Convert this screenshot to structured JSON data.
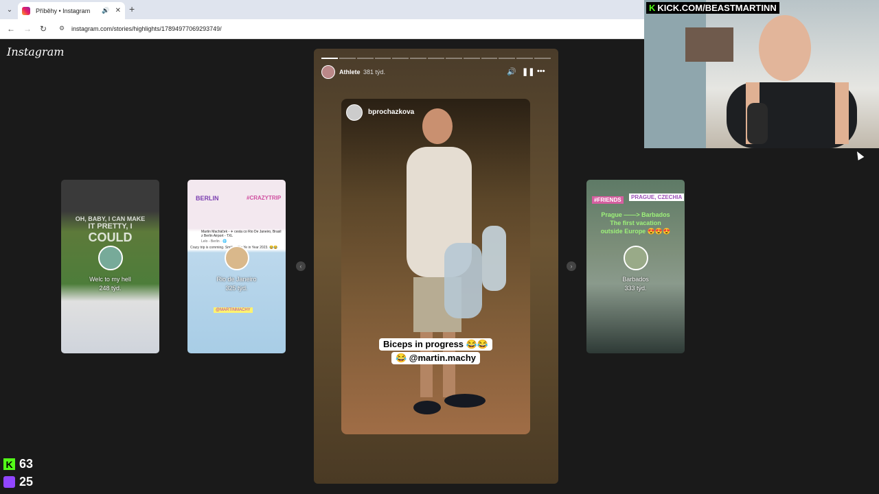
{
  "browser": {
    "tab_title": "Příběhy • Instagram",
    "url": "instagram.com/stories/highlights/17894977069293749/"
  },
  "instagram": {
    "logo": "Instagram"
  },
  "main_story": {
    "username": "Athlete",
    "time": "381 týd.",
    "inner_username": "bprochazkova",
    "caption_line1": "Biceps in progress 😂😂",
    "caption_line2": "😂 @martin.machy",
    "progress_segments": 13,
    "progress_current": 1
  },
  "side_stories": [
    {
      "name": "Welc to my hell",
      "age": "248 týd."
    },
    {
      "name": "Rio de Janeiro",
      "age": "325 týd."
    },
    {
      "name": "Barbados",
      "age": "333 týd."
    }
  ],
  "side_overlays": {
    "story1_text1": "OH, BABY, I CAN MAKE",
    "story1_text2": "IT PRETTY, I",
    "story1_text3": "COULD",
    "story2_tag1": "BERLIN",
    "story2_tag2": "#CRAZYTRIP",
    "story2_post_author": "Martin Macháček - ✈ cesta co Rio De Janeiro, Brasil z Berlin Airport - TXL",
    "story2_post_sub": "Lelo - Berlin · 🌐",
    "story2_post_body": "Crazy trip is comming. Smiling Rio Ye in Year 2023. 😂😂",
    "story2_handle": "@MARTINMACHY",
    "story3_tag1": "#FRIENDS",
    "story3_tag2": "PRAGUE, CZECHIA",
    "story3_text1": "Prague ——> Barbados",
    "story3_text2": "The first vacation",
    "story3_text3": "outside Europe 😍😍😍"
  },
  "stream": {
    "kick_url": "KICK.COM/BEASTMARTINN",
    "kick_viewers": "63",
    "twitch_viewers": "25"
  },
  "colors": {
    "kick": "#53fc18",
    "twitch": "#9146ff",
    "bg": "#1a1a1a"
  }
}
